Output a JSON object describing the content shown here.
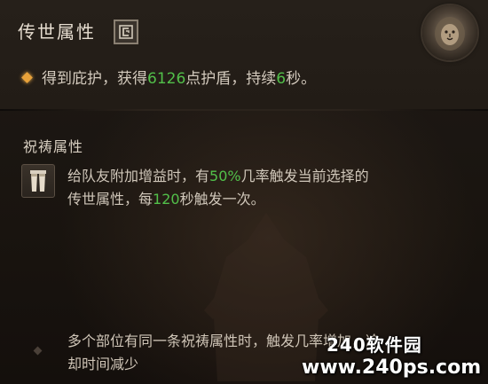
{
  "header": {
    "title": "传世属性",
    "type_icon": "legendary-rune-icon",
    "emblem_icon": "lion-crest-icon"
  },
  "effect": {
    "bullet_icon": "gold-diamond-icon",
    "text_a": "得到庇护，获得",
    "value_shield": "6126",
    "text_b": "点护盾，持续",
    "value_duration": "6",
    "text_c": "秒。"
  },
  "aspect": {
    "section_title": "祝祷属性",
    "icon": "leg-armor-icon",
    "line1_a": "给队友附加增益时，有",
    "line1_pct": "50%",
    "line1_b": "几率触发当前选择的",
    "line2_a": "传世属性，每",
    "line2_cd": "120",
    "line2_b": "秒触发一次。"
  },
  "footer": {
    "line1": "多个部位有同一条祝祷属性时，触发几率增加，冷",
    "line2": "却时间减少"
  },
  "watermark": {
    "line1": "240软件园",
    "line2": "www.240ps.com"
  },
  "colors": {
    "highlight_green": "#52c04a",
    "bullet_gold": "#e8a23a",
    "text": "#d0c7ba"
  }
}
